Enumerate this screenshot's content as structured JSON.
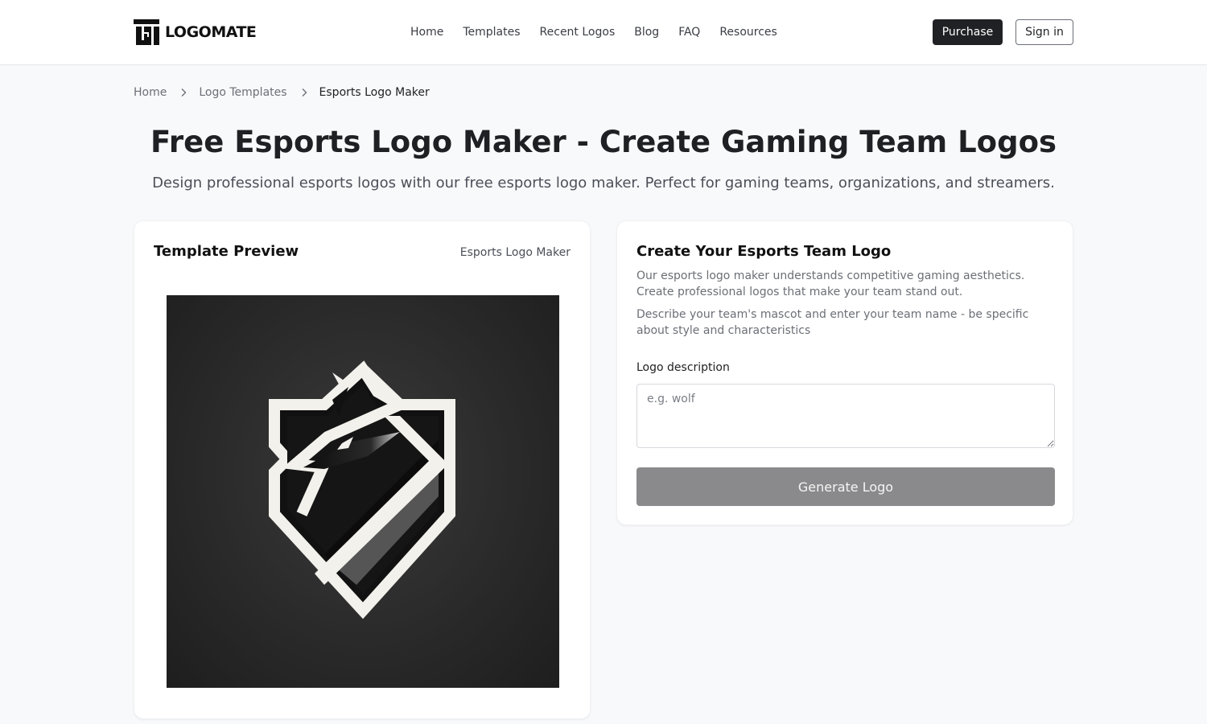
{
  "header": {
    "brand": "LOGOMATE",
    "nav": [
      {
        "label": "Home"
      },
      {
        "label": "Templates"
      },
      {
        "label": "Recent Logos"
      },
      {
        "label": "Blog"
      },
      {
        "label": "FAQ"
      },
      {
        "label": "Resources"
      }
    ],
    "purchase_label": "Purchase",
    "signin_label": "Sign in"
  },
  "breadcrumb": {
    "items": [
      {
        "label": "Home"
      },
      {
        "label": "Logo Templates"
      },
      {
        "label": "Esports Logo Maker"
      }
    ],
    "separator_icon": "chevron-right-icon"
  },
  "page": {
    "title": "Free Esports Logo Maker - Create Gaming Team Logos",
    "subtitle": "Design professional esports logos with our free esports logo maker. Perfect for gaming teams, organizations, and streamers."
  },
  "preview": {
    "title": "Template Preview",
    "tag": "Esports Logo Maker",
    "image_alt": "Wolf head esports shield logo, white outline on dark background"
  },
  "create": {
    "title": "Create Your Esports Team Logo",
    "description_1": "Our esports logo maker understands competitive gaming aesthetics. Create professional logos that make your team stand out.",
    "description_2": "Describe your team's mascot and enter your team name - be specific about style and characteristics",
    "field_label": "Logo description",
    "field_placeholder": "e.g. wolf",
    "field_value": "",
    "generate_label": "Generate Logo"
  },
  "colors": {
    "primary_button": "#1f2124",
    "generate_disabled": "#8a8a8c",
    "page_bg": "#f8f9fb"
  }
}
